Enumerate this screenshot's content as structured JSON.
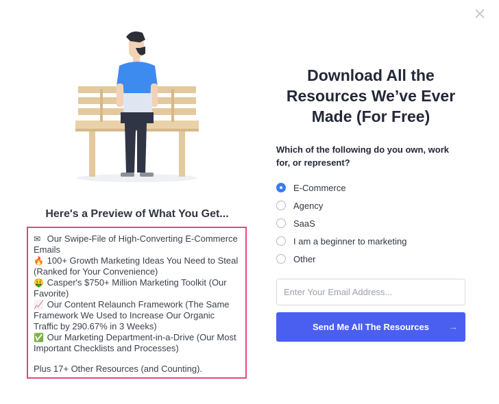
{
  "modal": {
    "close_icon": "close-icon"
  },
  "preview": {
    "title": "Here's a Preview of What You Get...",
    "items": [
      {
        "emoji": "✉",
        "icon": "envelope-icon",
        "text": "Our Swipe-File of High-Converting E-Commerce Emails"
      },
      {
        "emoji": "🔥",
        "icon": "fire-icon",
        "text": "100+ Growth Marketing Ideas You Need to Steal (Ranked for Your Convenience)"
      },
      {
        "emoji": "🤑",
        "icon": "money-face-icon",
        "text": "Casper's $750+ Million Marketing Toolkit (Our Favorite)"
      },
      {
        "emoji": "📈",
        "icon": "chart-up-icon",
        "text": "Our Content Relaunch Framework (The Same Framework We Used to Increase Our Organic Traffic by 290.67% in 3 Weeks)"
      },
      {
        "emoji": "✅",
        "icon": "check-mark-icon",
        "text": "Our Marketing Department-in-a-Drive (Our Most Important Checklists and Processes)"
      }
    ],
    "footer": "Plus 17+ Other Resources (and Counting).",
    "highlight_color": "#e8457a"
  },
  "form": {
    "headline": "Download All the Resources We’ve Ever Made (For Free)",
    "question": "Which of the following do you own, work for, or represent?",
    "options": [
      {
        "label": "E-Commerce",
        "selected": true
      },
      {
        "label": "Agency",
        "selected": false
      },
      {
        "label": "SaaS",
        "selected": false
      },
      {
        "label": "I am a beginner to marketing",
        "selected": false
      },
      {
        "label": "Other",
        "selected": false
      }
    ],
    "email_placeholder": "Enter Your Email Address...",
    "email_value": "",
    "submit_label": "Send Me All The Resources",
    "submit_arrow": "→",
    "accent_color": "#4a5ff0",
    "radio_selected_color": "#3a7bef"
  }
}
